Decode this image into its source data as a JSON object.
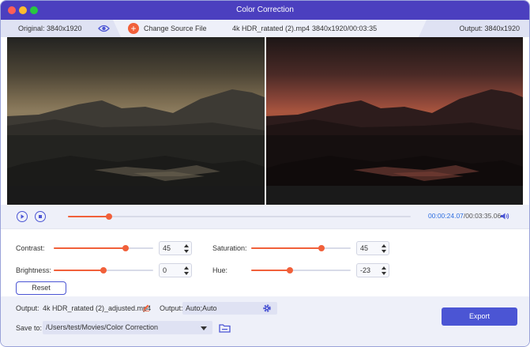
{
  "window": {
    "title": "Color Correction"
  },
  "infobar": {
    "original_label": "Original: 3840x1920",
    "change_source_label": "Change Source File",
    "file_name": "4k HDR_ratated (2).mp4",
    "file_info": "3840x1920/00:03:35",
    "output_label": "Output: 3840x1920"
  },
  "playback": {
    "current_time": "00:00:24.07",
    "total_time": "/00:03:35.06",
    "progress": 0.12
  },
  "adjust": {
    "contrast": {
      "label": "Contrast:",
      "value": "45",
      "level": 0.72
    },
    "saturation": {
      "label": "Saturation:",
      "value": "45",
      "level": 0.71
    },
    "brightness": {
      "label": "Brightness:",
      "value": "0",
      "level": 0.5
    },
    "hue": {
      "label": "Hue:",
      "value": "-23",
      "level": 0.39
    },
    "reset_label": "Reset"
  },
  "footer": {
    "output_label": "Output:",
    "output_file": "4k HDR_ratated (2)_adjusted.mp4",
    "output_format_label": "Output:",
    "output_format_value": "Auto;Auto",
    "save_label": "Save to:",
    "save_path": "/Users/test/Movies/Color Correction",
    "export_label": "Export"
  },
  "colors": {
    "accent": "#4b55d4",
    "titlebar": "#4b3fbf",
    "slider": "#f1603a"
  }
}
